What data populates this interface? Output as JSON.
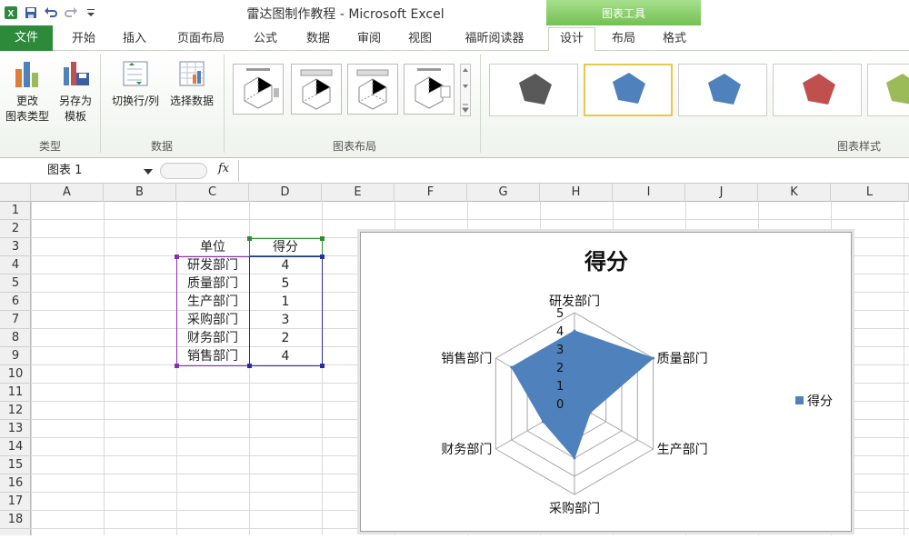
{
  "window": {
    "title": "雷达图制作教程 - Microsoft Excel",
    "context_header": "图表工具"
  },
  "tabs": [
    "文件",
    "开始",
    "插入",
    "页面布局",
    "公式",
    "数据",
    "审阅",
    "视图",
    "福昕阅读器",
    "设计",
    "布局",
    "格式"
  ],
  "ribbon": {
    "groups": {
      "type": "类型",
      "data": "数据",
      "layout": "图表布局",
      "style": "图表样式"
    },
    "change_type": [
      "更改",
      "图表类型"
    ],
    "save_template": [
      "另存为",
      "模板"
    ],
    "switch_rowcol": "切换行/列",
    "select_data": "选择数据"
  },
  "formula_bar": {
    "name_box": "图表 1",
    "fx": "fx",
    "content": ""
  },
  "columns": [
    "A",
    "B",
    "C",
    "D",
    "E",
    "F",
    "G",
    "H",
    "I",
    "J",
    "K",
    "L"
  ],
  "rows": [
    "1",
    "2",
    "3",
    "4",
    "5",
    "6",
    "7",
    "8",
    "9",
    "10",
    "11",
    "12",
    "13",
    "14",
    "15",
    "16",
    "17",
    "18"
  ],
  "table": {
    "header_unit": "单位",
    "header_score": "得分",
    "rows": [
      {
        "unit": "研发部门",
        "score": "4"
      },
      {
        "unit": "质量部门",
        "score": "5"
      },
      {
        "unit": "生产部门",
        "score": "1"
      },
      {
        "unit": "采购部门",
        "score": "3"
      },
      {
        "unit": "财务部门",
        "score": "2"
      },
      {
        "unit": "销售部门",
        "score": "4"
      }
    ]
  },
  "colors": {
    "series": "#4f81bd",
    "excel_green": "#2d8a3a",
    "context_green": "#74c052"
  },
  "chart_data": {
    "type": "radar",
    "title": "得分",
    "categories": [
      "研发部门",
      "质量部门",
      "生产部门",
      "采购部门",
      "财务部门",
      "销售部门"
    ],
    "series": [
      {
        "name": "得分",
        "values": [
          4,
          5,
          1,
          3,
          2,
          4
        ]
      }
    ],
    "axis_ticks": [
      "0",
      "1",
      "2",
      "3",
      "4",
      "5"
    ],
    "rlim": [
      0,
      5
    ],
    "grid": true,
    "legend": "right"
  }
}
